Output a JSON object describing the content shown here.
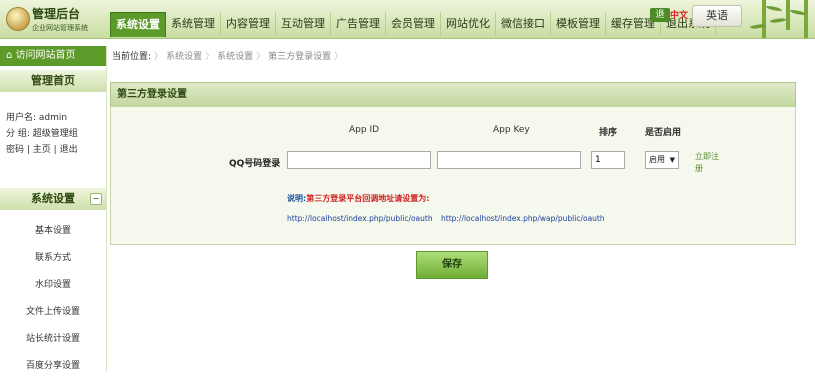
{
  "header": {
    "logo_title": "管理后台",
    "logo_subtitle": "企业网站管理系统",
    "nav": [
      "系统设置",
      "系统管理",
      "内容管理",
      "互动管理",
      "广告管理",
      "会员管理",
      "网站优化",
      "微信接口",
      "模板管理",
      "缓存管理",
      "退出系统"
    ],
    "exit_badge": "退",
    "red_text": "中文",
    "lang_button": "英语"
  },
  "sidebar": {
    "visit_site": "访问网站首页",
    "home": "管理首页",
    "user_line": "用户名: admin",
    "group_line": "分  组: 超级管理组",
    "links": [
      "密码",
      "主页",
      "退出"
    ],
    "link_sep": " | ",
    "section_title": "系统设置",
    "collapse_symbol": "−",
    "items": [
      "基本设置",
      "联系方式",
      "水印设置",
      "文件上传设置",
      "站长统计设置",
      "百度分享设置"
    ]
  },
  "breadcrumb": {
    "label": "当前位置:",
    "items": [
      "系统设置",
      "系统设置",
      "第三方登录设置"
    ]
  },
  "panel": {
    "title": "第三方登录设置",
    "columns": {
      "app_id": "App ID",
      "app_key": "App Key",
      "sort": "排序",
      "enabled": "是否启用"
    },
    "row": {
      "label": "QQ号码登录",
      "app_id_value": "",
      "app_key_value": "",
      "sort_value": "1",
      "enabled_value": "启用",
      "link": "立即注册"
    },
    "note_lead": "说明:",
    "note_text": "第三方登录平台回调地址请设置为:",
    "callback_links": [
      "http://localhost/index.php/public/oauth",
      "http://localhost/index.php/wap/public/oauth"
    ]
  },
  "actions": {
    "save": "保存"
  },
  "colors": {
    "accent": "#5c9a2a",
    "note": "#d02020",
    "link": "#1c3fa0"
  }
}
